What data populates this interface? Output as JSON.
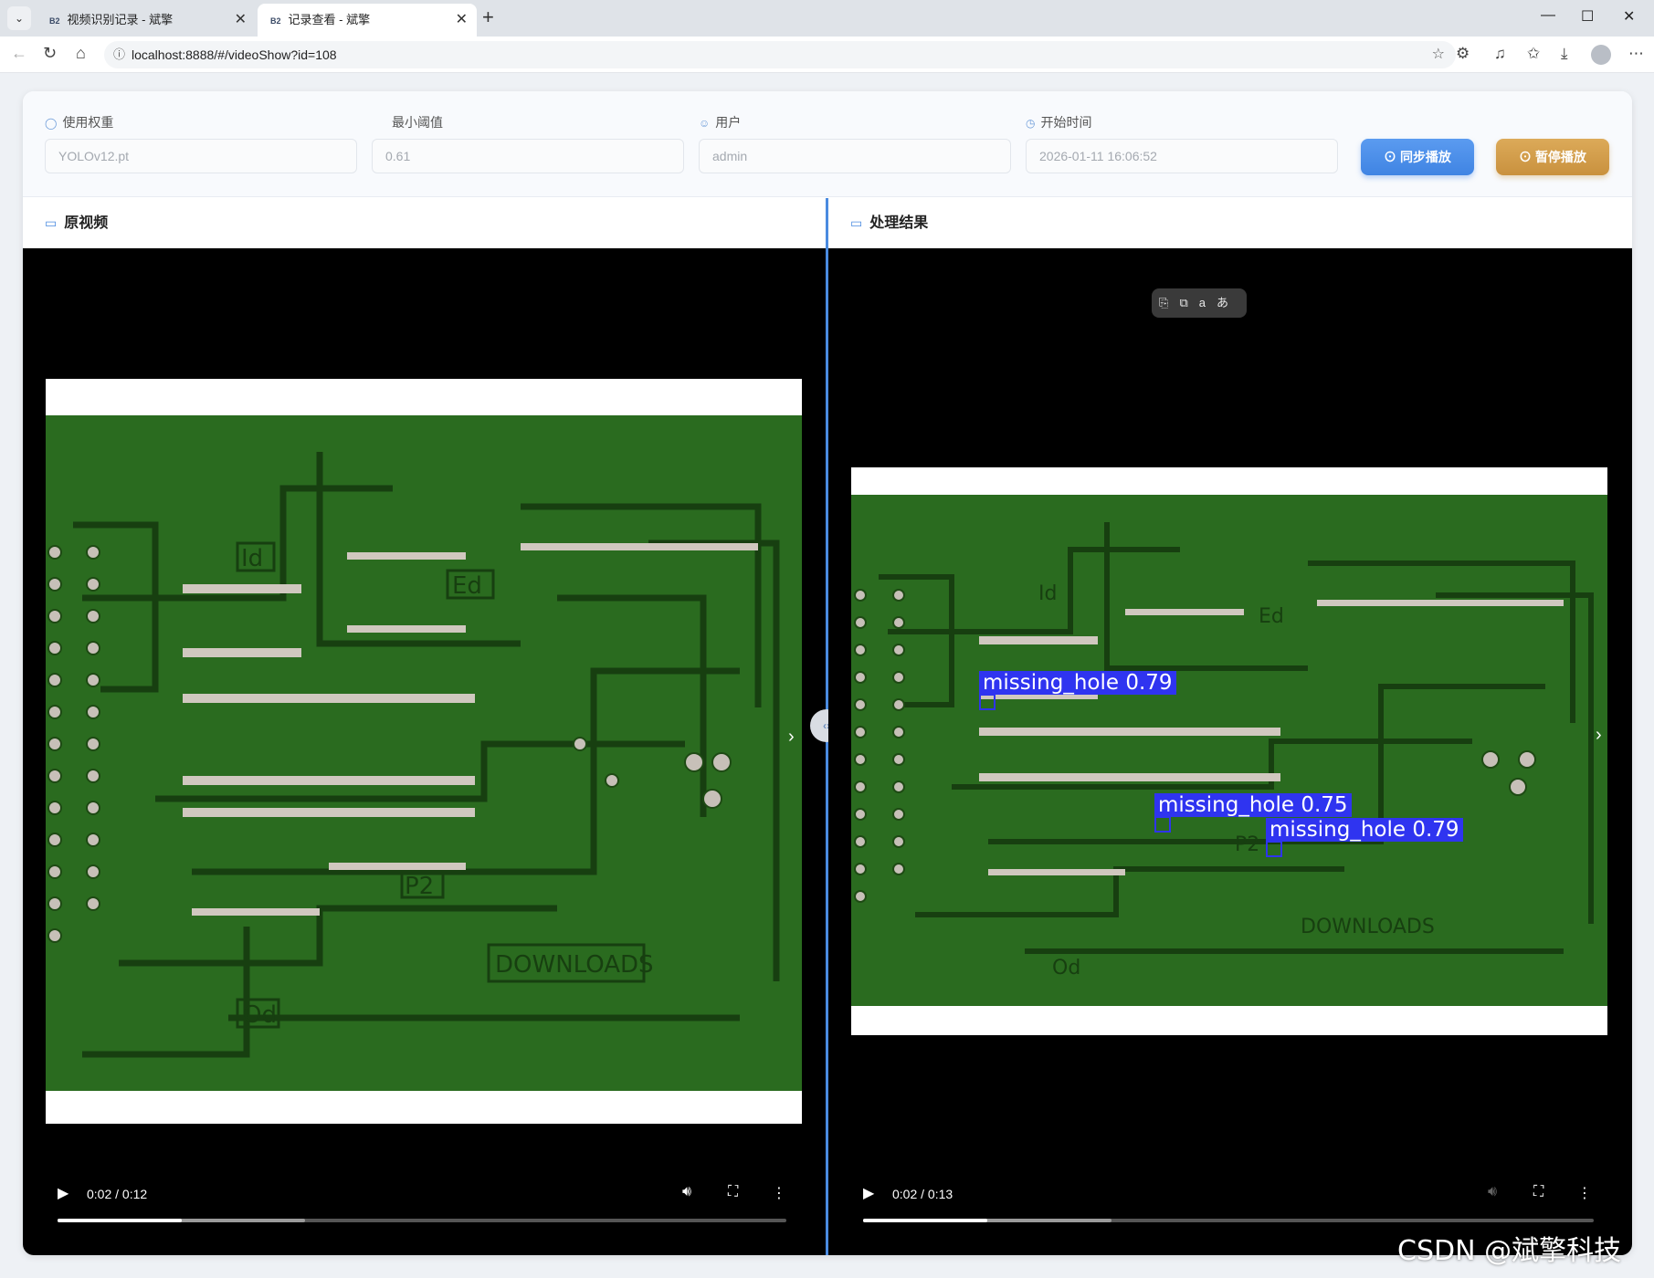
{
  "browser": {
    "tabs": [
      {
        "favicon": "B2",
        "title": "视频识别记录 - 斌擎",
        "close": "✕"
      },
      {
        "favicon": "B2",
        "title": "记录查看 - 斌擎",
        "close": "✕"
      }
    ],
    "new_tab": "+",
    "window": {
      "minimize": "—",
      "maximize": "☐",
      "close": "✕"
    },
    "url": "localhost:8888/#/videoShow?id=108"
  },
  "form": {
    "weight": {
      "label": "使用权重",
      "value": "YOLOv12.pt"
    },
    "threshold": {
      "label": "最小阈值",
      "value": "0.61"
    },
    "user": {
      "label": "用户",
      "value": "admin"
    },
    "start_time": {
      "label": "开始时间",
      "value": "2026-01-11 16:06:52"
    },
    "sync_button": "同步播放",
    "pause_button": "暂停播放"
  },
  "panels": {
    "original": {
      "title": "原视频",
      "time": "0:02 / 0:12",
      "progress": 0.17,
      "buffered": 0.34,
      "pcb_text": [
        "Id",
        "Ed",
        "P2",
        "DOWNLOADS",
        "Od"
      ]
    },
    "result": {
      "title": "处理结果",
      "time": "0:02 / 0:13",
      "progress": 0.17,
      "buffered": 0.34,
      "detections": [
        {
          "label": "missing_hole 0.79"
        },
        {
          "label": "missing_hole 0.75"
        },
        {
          "label": "missing_hole 0.79"
        }
      ],
      "pip_icons": [
        "⎘",
        "⧉",
        "aあ"
      ]
    }
  },
  "watermark": "CSDN @斌擎科技",
  "colors": {
    "accent": "#4a8be0",
    "sync": "#4a8de8",
    "pause": "#d4a04c",
    "detection": "#2f34f0",
    "pcb": "#2a6b1f"
  }
}
